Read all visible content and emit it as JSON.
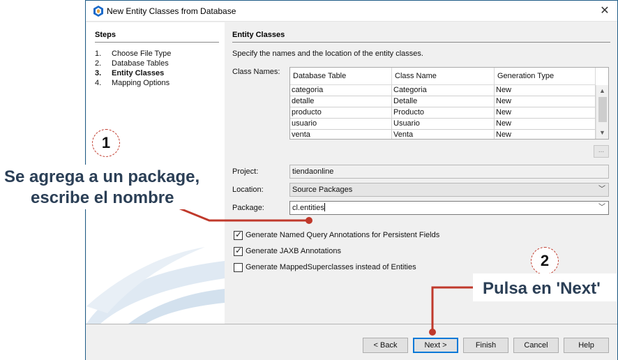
{
  "window": {
    "title": "New Entity Classes from Database",
    "close_glyph": "✕"
  },
  "steps": {
    "heading": "Steps",
    "items": [
      {
        "num": "1.",
        "label": "Choose File Type"
      },
      {
        "num": "2.",
        "label": "Database Tables"
      },
      {
        "num": "3.",
        "label": "Entity Classes",
        "active": true
      },
      {
        "num": "4.",
        "label": "Mapping Options"
      }
    ]
  },
  "content": {
    "heading": "Entity Classes",
    "description": "Specify the names and the location of the entity classes.",
    "class_names_label": "Class Names:",
    "table": {
      "columns": [
        "Database Table",
        "Class Name",
        "Generation Type"
      ],
      "rows": [
        [
          "categoria",
          "Categoria",
          "New"
        ],
        [
          "detalle",
          "Detalle",
          "New"
        ],
        [
          "producto",
          "Producto",
          "New"
        ],
        [
          "usuario",
          "Usuario",
          "New"
        ],
        [
          "venta",
          "Venta",
          "New"
        ]
      ]
    },
    "ellipsis_label": "...",
    "project_label": "Project:",
    "project_value": "tiendaonline",
    "location_label": "Location:",
    "location_value": "Source Packages",
    "package_label": "Package:",
    "package_value": "cl.entities",
    "checkboxes": [
      {
        "label": "Generate Named Query Annotations for Persistent Fields",
        "checked": true
      },
      {
        "label": "Generate JAXB Annotations",
        "checked": true
      },
      {
        "label": "Generate MappedSuperclasses instead of Entities",
        "checked": false
      }
    ]
  },
  "buttons": {
    "back": "< Back",
    "next": "Next >",
    "finish": "Finish",
    "cancel": "Cancel",
    "help": "Help"
  },
  "annotations": {
    "step1_number": "1",
    "step1_line1": "Se agrega a un package,",
    "step1_line2": "escribe el nombre",
    "step2_number": "2",
    "step2_text": "Pulsa en 'Next'"
  },
  "colors": {
    "annotation_red": "#c0392b",
    "annotation_text": "#2b3f56",
    "window_border": "#1e5b86",
    "default_button_border": "#0078d7"
  }
}
